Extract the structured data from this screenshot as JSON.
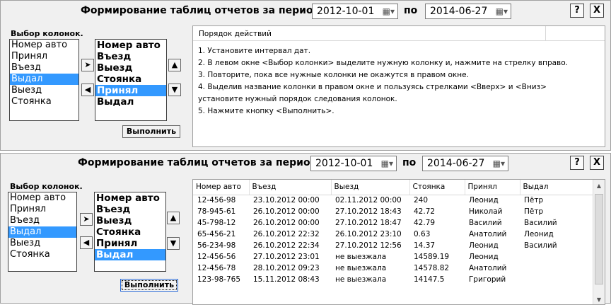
{
  "header": {
    "title": "Формирование таблиц отчетов за период с",
    "date_from": "2012-10-01",
    "po": "по",
    "date_to": "2014-06-27",
    "help_label": "?",
    "close_label": "X"
  },
  "columns_label": "Выбор колонок.",
  "left_list": [
    "Номер авто",
    "Принял",
    "Въезд",
    "Выдал",
    "Выезд",
    "Стоянка"
  ],
  "right_list_top": [
    "Номер авто",
    "Въезд",
    "Выезд",
    "Стоянка",
    "Принял",
    "Выдал"
  ],
  "right_list_bottom": [
    "Номер авто",
    "Въезд",
    "Выезд",
    "Стоянка",
    "Принял",
    "Выдал"
  ],
  "run_label": "Выполнить",
  "instructions": {
    "header": "Порядок действий",
    "steps": [
      "1. Установите интервал дат.",
      "2. В левом окне <Выбор колонки> выделите нужную колонку и, нажмите на стрелку вправо.",
      "3. Повторите, пока все нужные колонки не окажутся в правом окне.",
      "4. Выделив название колонки в правом окне и пользуясь стрелками <Вверх> и <Вниз>",
      "установите нужный порядок следования колонок.",
      "5. Нажмите кнопку <Выполнить>."
    ]
  },
  "table": {
    "headers": [
      "Номер авто",
      "Въезд",
      "Выезд",
      "Стоянка",
      "Принял",
      "Выдал"
    ],
    "rows": [
      [
        "12-456-98",
        "23.10.2012 00:00",
        "02.11.2012 00:00",
        "240",
        "Леонид",
        "Пётр"
      ],
      [
        "78-945-61",
        "26.10.2012 00:00",
        "27.10.2012 18:43",
        "42.72",
        "Николай",
        "Пётр"
      ],
      [
        "45-798-12",
        "26.10.2012 00:00",
        "27.10.2012 18:47",
        "42.79",
        "Василий",
        "Василий"
      ],
      [
        "65-456-21",
        "26.10.2012 22:32",
        "26.10.2012 23:10",
        "0.63",
        "Анатолий",
        "Леонид"
      ],
      [
        "56-234-98",
        "26.10.2012 22:34",
        "27.10.2012 12:56",
        "14.37",
        "Леонид",
        "Василий"
      ],
      [
        "12-456-56",
        "27.10.2012 23:01",
        "  не выезжала",
        "14589.19",
        "Леонид",
        ""
      ],
      [
        "12-456-78",
        "28.10.2012 09:23",
        "  не выезжала",
        "14578.82",
        "Анатолий",
        ""
      ],
      [
        "123-98-765",
        "15.11.2012 08:43",
        "  не выезжала",
        "14147.5",
        "Григорий",
        ""
      ],
      [
        "",
        "",
        "",
        "",
        "",
        ""
      ]
    ]
  },
  "colors": {
    "selection": "#3399ff",
    "panel": "#f0f0f0"
  },
  "icons": {
    "right": "arrow-right-icon",
    "left": "arrow-left-icon",
    "up": "arrow-up-icon",
    "down": "arrow-down-icon",
    "calendar": "calendar-icon"
  }
}
